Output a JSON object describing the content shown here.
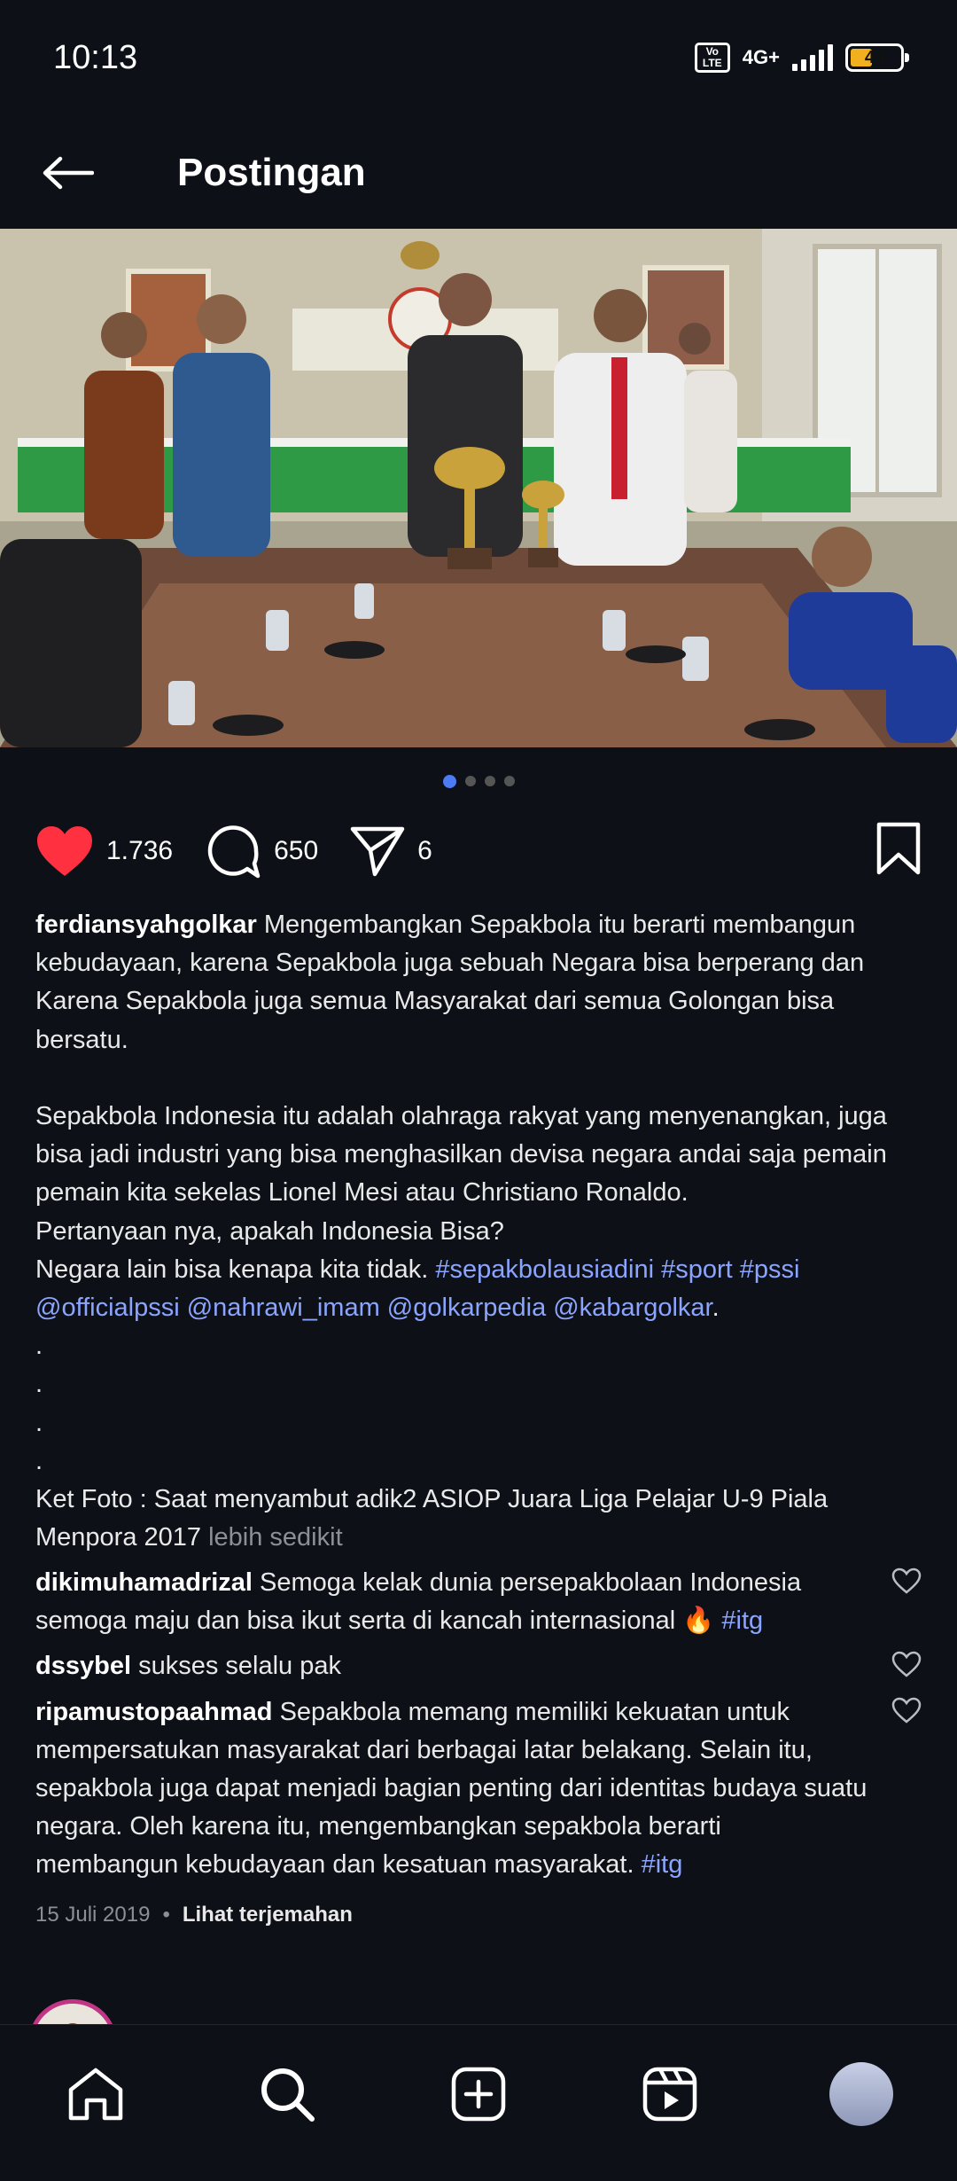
{
  "status_bar": {
    "time": "10:13",
    "volte": "Vo LTE",
    "network": "4G+",
    "battery": "44",
    "battery_level": 0.44
  },
  "header": {
    "title": "Postingan",
    "back_icon": "arrow-left-icon"
  },
  "carousel": {
    "count": 4,
    "active_index": 0,
    "accent_color": "#4c7bf3"
  },
  "actions": {
    "likes": "1.736",
    "comments": "650",
    "shares": "6",
    "like_color": "#ff3040"
  },
  "caption": {
    "username": "ferdiansyahgolkar",
    "para1": "Mengembangkan Sepakbola itu berarti membangun kebudayaan, karena Sepakbola juga sebuah Negara bisa berperang dan Karena Sepakbola juga semua Masyarakat dari semua Golongan bisa bersatu.",
    "para2": "Sepakbola Indonesia itu adalah olahraga rakyat yang menyenangkan, juga bisa jadi industri yang bisa menghasilkan devisa negara andai saja pemain pemain kita sekelas Lionel Mesi atau Christiano Ronaldo.\nPertanyaan nya, apakah Indonesia Bisa?\nNegara lain bisa kenapa kita tidak. ",
    "tags": "#sepakbolausiadini #sport #pssi @officialpssi @nahrawi_imam @golkarpedia @kabargolkar",
    "period": ".",
    "dots": ".\n.\n.\n.",
    "photo_note": "Ket Foto : Saat menyambut adik2 ASIOP Juara Liga Pelajar U-9 Piala Menpora 2017 ",
    "less": "lebih sedikit"
  },
  "comments": [
    {
      "user": "dikimuhamadrizal",
      "text": "Semoga kelak dunia persepakbolaan Indonesia semoga maju dan bisa ikut serta di kancah internasional 🔥 ",
      "tag": "#itg"
    },
    {
      "user": "dssybel",
      "text": "sukses selalu pak",
      "tag": ""
    },
    {
      "user": "ripamustopaahmad",
      "text": "Sepakbola memang memiliki kekuatan untuk mempersatukan masyarakat dari berbagai latar belakang. Selain itu, sepakbola juga dapat menjadi bagian penting dari identitas budaya suatu negara. Oleh karena itu, mengembangkan sepakbola berarti membangun kebudayaan dan kesatuan masyarakat. ",
      "tag": "#itg"
    }
  ],
  "meta": {
    "date": "15 Juli 2019",
    "separator": "•",
    "translate": "Lihat terjemahan"
  },
  "nav": [
    "home-icon",
    "search-icon",
    "create-icon",
    "reels-icon",
    "profile-avatar"
  ]
}
